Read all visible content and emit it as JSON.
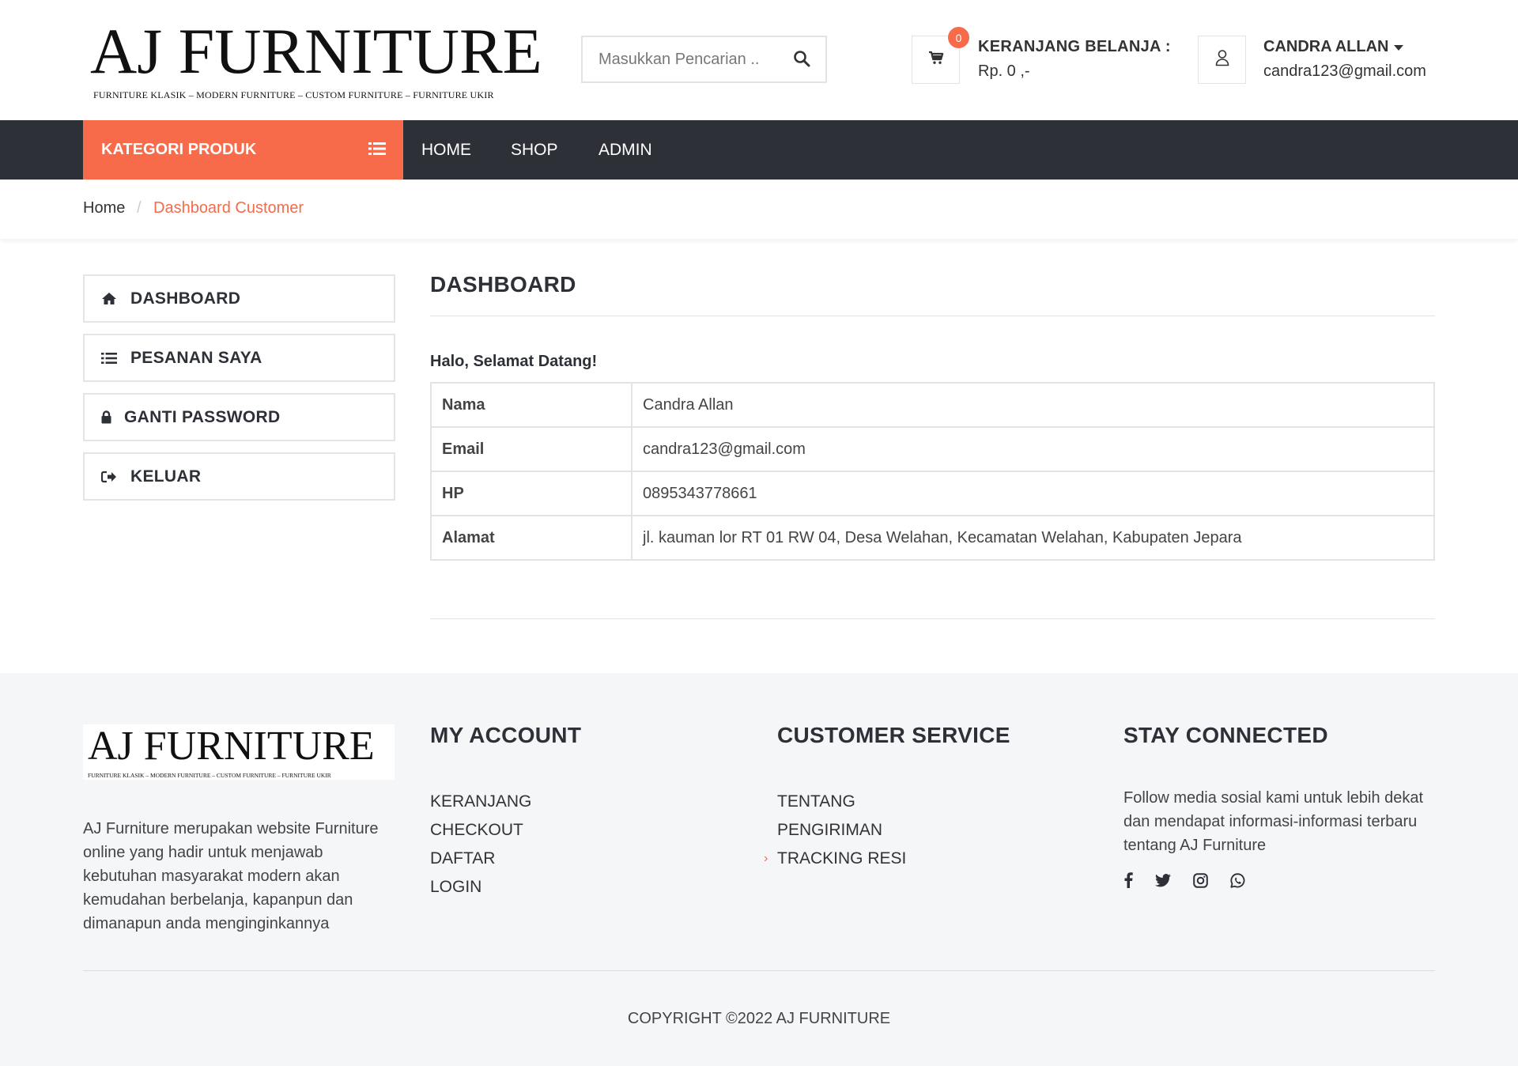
{
  "brand": {
    "logo_text": "AJ FURNITURE",
    "logo_tagline": "FURNITURE KLASIK – MODERN FURNITURE – CUSTOM FURNITURE – FURNITURE UKIR"
  },
  "search": {
    "placeholder": "Masukkan Pencarian .."
  },
  "cart": {
    "count": "0",
    "title": "KERANJANG BELANJA :",
    "total": "Rp. 0 ,-"
  },
  "user": {
    "name": "CANDRA ALLAN",
    "email": "candra123@gmail.com"
  },
  "nav": {
    "category_label": "KATEGORI PRODUK",
    "links": [
      "HOME",
      "SHOP",
      "ADMIN"
    ]
  },
  "breadcrumb": {
    "home": "Home",
    "separator": "/",
    "current": "Dashboard Customer"
  },
  "sidebar": {
    "items": [
      {
        "label": "DASHBOARD",
        "icon": "home-icon"
      },
      {
        "label": "PESANAN SAYA",
        "icon": "list-icon"
      },
      {
        "label": "GANTI PASSWORD",
        "icon": "lock-icon"
      },
      {
        "label": "KELUAR",
        "icon": "sign-out-icon"
      }
    ]
  },
  "dashboard": {
    "title": "DASHBOARD",
    "greeting": "Halo, Selamat Datang!",
    "rows": [
      {
        "key": "Nama",
        "value": "Candra Allan"
      },
      {
        "key": "Email",
        "value": "candra123@gmail.com"
      },
      {
        "key": "HP",
        "value": "0895343778661"
      },
      {
        "key": "Alamat",
        "value": "jl. kauman lor RT 01 RW 04, Desa Welahan, Kecamatan Welahan, Kabupaten Jepara"
      }
    ]
  },
  "footer": {
    "about": "AJ Furniture merupakan website Furniture online yang hadir untuk menjawab kebutuhan masyarakat modern akan kemudahan berbelanja, kapanpun dan dimanapun anda menginginkannya",
    "my_account": {
      "title": "MY ACCOUNT",
      "links": [
        "KERANJANG",
        "CHECKOUT",
        "DAFTAR",
        "LOGIN"
      ]
    },
    "customer_service": {
      "title": "CUSTOMER SERVICE",
      "links": [
        "TENTANG",
        "PENGIRIMAN",
        "TRACKING RESI"
      ]
    },
    "stay_connected": {
      "title": "STAY CONNECTED",
      "text": "Follow media sosial kami untuk lebih dekat dan mendapat informasi-informasi terbaru tentang AJ Furniture",
      "icons": [
        "facebook-icon",
        "twitter-icon",
        "instagram-icon",
        "whatsapp-icon"
      ]
    },
    "copyright": "COPYRIGHT ©2022 AJ FURNITURE"
  },
  "colors": {
    "accent": "#f76a4a",
    "navbar": "#2e3038",
    "footer_bg": "#f5f6f8"
  }
}
